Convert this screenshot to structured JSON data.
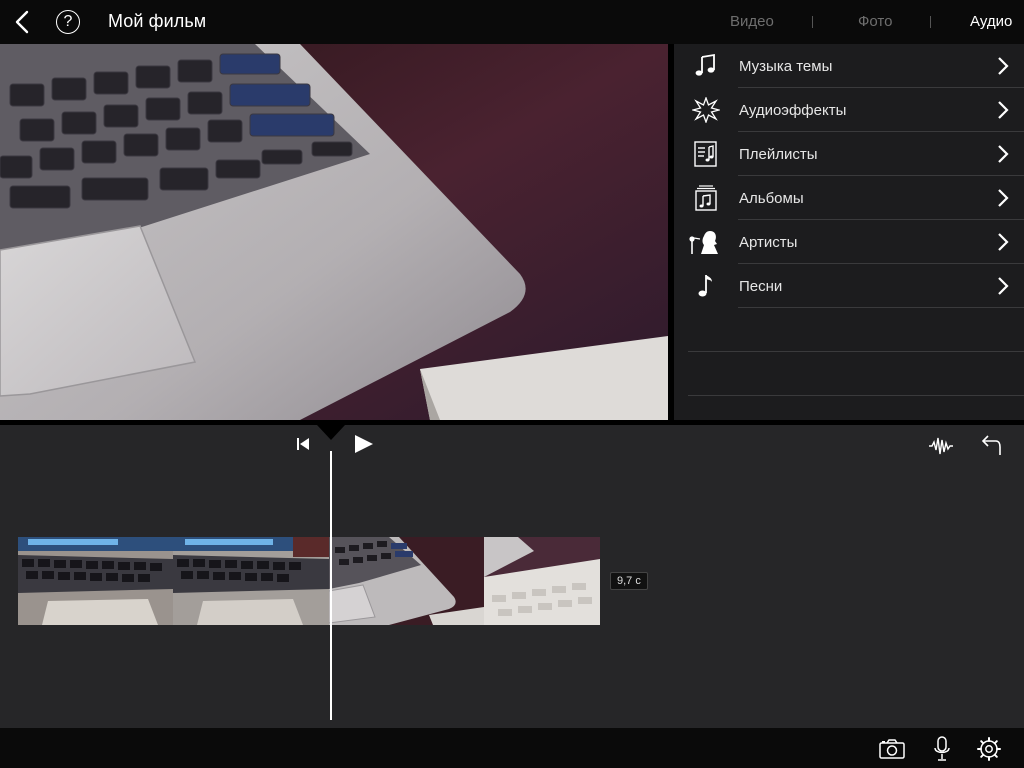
{
  "header": {
    "title": "Мой фильм",
    "help_label": "?",
    "tabs": [
      {
        "label": "Видео",
        "active": false
      },
      {
        "label": "Фото",
        "active": false
      },
      {
        "label": "Аудио",
        "active": true
      }
    ]
  },
  "audio_browser": {
    "items": [
      {
        "label": "Музыка темы",
        "icon": "music-note-icon"
      },
      {
        "label": "Аудиоэффекты",
        "icon": "starburst-icon"
      },
      {
        "label": "Плейлисты",
        "icon": "playlist-icon"
      },
      {
        "label": "Альбомы",
        "icon": "album-icon"
      },
      {
        "label": "Артисты",
        "icon": "artist-icon"
      },
      {
        "label": "Песни",
        "icon": "song-icon"
      }
    ]
  },
  "timeline": {
    "duration_label": "9,7 с",
    "controls": [
      "skip-to-start-icon",
      "play-icon",
      "audio-waveform-icon",
      "undo-icon"
    ]
  },
  "bottom_toolbar": {
    "buttons": [
      "camera-icon",
      "microphone-icon",
      "settings-gear-icon"
    ]
  },
  "colors": {
    "background": "#000000",
    "panel": "#1c1c1e",
    "timeline": "#262628",
    "active_tab": "#ffffff",
    "inactive_tab": "#6e6e6e"
  }
}
